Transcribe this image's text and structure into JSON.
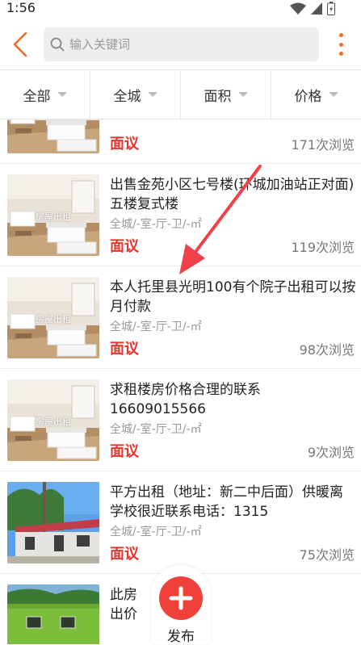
{
  "status_bar": {
    "time": "1:56"
  },
  "search": {
    "placeholder": "输入关键词"
  },
  "filters": [
    {
      "label": "全部"
    },
    {
      "label": "全城"
    },
    {
      "label": "面积"
    },
    {
      "label": "价格"
    }
  ],
  "listings": [
    {
      "title": "",
      "meta": "",
      "price": "面议",
      "views": "171次浏览",
      "thumb_label": "",
      "thumb": "room"
    },
    {
      "title": "出售金苑小区七号楼(环城加油站正对面) 五楼复式楼",
      "meta": "全城/-室-厅-卫/-㎡",
      "price": "面议",
      "views": "119次浏览",
      "thumb_label": "房屋出租",
      "thumb": "room"
    },
    {
      "title": "本人托里县光明100有个院子出租可以按月付款",
      "meta": "全城/-室-厅-卫/-㎡",
      "price": "面议",
      "views": "98次浏览",
      "thumb_label": "房屋出租",
      "thumb": "room"
    },
    {
      "title": "求租楼房价格合理的联系16609015566",
      "meta": "全城/-室-厅-卫/-㎡",
      "price": "面议",
      "views": "9次浏览",
      "thumb_label": "房屋出租",
      "thumb": "room"
    },
    {
      "title": "平方出租（地址：新二中后面）供暖离学校很近联系电话：1315",
      "meta": "全城/-室-厅-卫/-㎡",
      "price": "面议",
      "views": "75次浏览",
      "thumb_label": "",
      "thumb": "house"
    },
    {
      "title": "此房出价格面",
      "meta": "",
      "price": "",
      "views": "",
      "thumb_label": "",
      "thumb": "green"
    }
  ],
  "fab": {
    "label": "发布"
  },
  "colors": {
    "accent": "#f26b2b",
    "price": "#e5352d",
    "fab": "#f0403a"
  }
}
